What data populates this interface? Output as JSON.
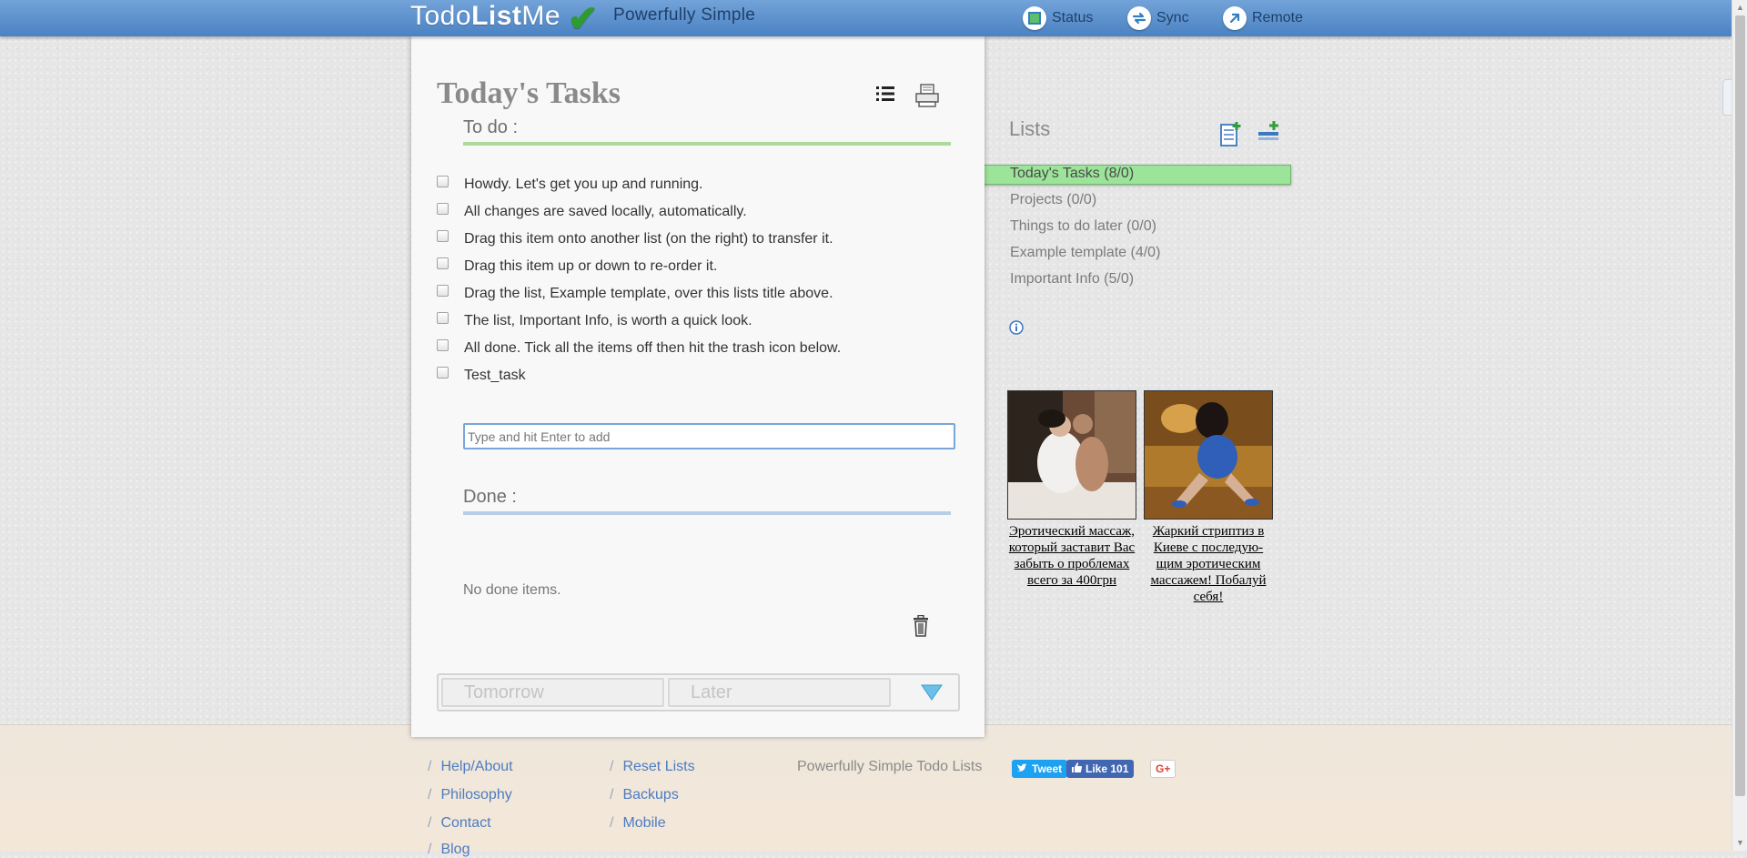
{
  "header": {
    "logo_light": "Todo",
    "logo_bold": "List",
    "logo_tail": "Me",
    "tagline": "Powerfully Simple",
    "nav": {
      "status": "Status",
      "sync": "Sync",
      "remote": "Remote"
    }
  },
  "panel": {
    "title": "Today's Tasks",
    "todo_heading": "To do :",
    "tasks": [
      "Howdy. Let's get you up and running.",
      "All changes are saved locally, automatically.",
      "Drag this item onto another list (on the right) to transfer it.",
      "Drag this item up or down to re-order it.",
      "Drag the list, Example template, over this lists title above.",
      "The list, Important Info, is worth a quick look.",
      "All done. Tick all the items off then hit the trash icon below.",
      "Test_task"
    ],
    "add_placeholder": "Type and hit Enter to add",
    "done_heading": "Done :",
    "no_done": "No done items.",
    "tabs": {
      "tomorrow": "Tomorrow",
      "later": "Later"
    }
  },
  "sidebar": {
    "title": "Lists",
    "lists": [
      "Today's Tasks (8/0)",
      "Projects (0/0)",
      "Things to do later (0/0)",
      "Example template (4/0)",
      "Important Info (5/0)"
    ],
    "active_index": 0
  },
  "ads": [
    {
      "caption": "Эротический массаж, который заставит Вас забыть о проблемах всего за 400грн"
    },
    {
      "caption": "Жаркий стриптиз в Киеве с последую-щим эротическим массажем! Побалуй себя!"
    }
  ],
  "footer": {
    "col1": [
      "Help/About",
      "Philosophy",
      "Contact",
      "Blog"
    ],
    "col2": [
      "Reset Lists",
      "Backups",
      "Mobile"
    ],
    "tagline": "Powerfully Simple Todo Lists",
    "tweet": "Tweet",
    "like": "Like 101",
    "gplus": "G+"
  },
  "colors": {
    "header_blue": "#4b82c3",
    "active_list_green": "#9ce49a",
    "todo_rule": "#a8dc98",
    "done_rule": "#b7cfe6",
    "link_blue": "#4d7cc0"
  }
}
